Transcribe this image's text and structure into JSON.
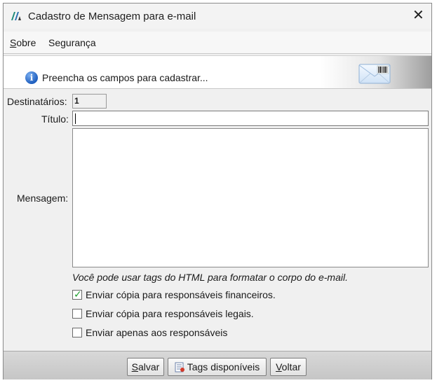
{
  "window": {
    "title": "Cadastro de Mensagem para e-mail",
    "close_symbol": "✕"
  },
  "menu": {
    "items": [
      {
        "label_first": "S",
        "label_rest": "obre"
      },
      {
        "label_first": "",
        "label_rest": "Segurança"
      }
    ]
  },
  "banner": {
    "info_symbol": "i",
    "text": "Preencha os campos para cadastrar...",
    "icon": "envelope-barcode-icon"
  },
  "form": {
    "destinatarios_label": "Destinatários:",
    "destinatarios_value": "1",
    "titulo_label": "Título:",
    "titulo_value": "",
    "mensagem_label": "Mensagem:",
    "mensagem_value": "",
    "hint": "Você pode usar tags do HTML para formatar o corpo do e-mail."
  },
  "options": [
    {
      "label": "Enviar cópia para responsáveis financeiros.",
      "checked": true
    },
    {
      "label": "Enviar cópia para responsáveis legais.",
      "checked": false
    },
    {
      "label": "Enviar apenas aos responsáveis",
      "checked": false
    }
  ],
  "buttons": {
    "save_first": "S",
    "save_rest": "alvar",
    "tags_label": "Tags disponíveis",
    "back_first": "V",
    "back_rest": "oltar"
  },
  "colors": {
    "check": "#1e9e2e",
    "info": "#1f5fbf"
  }
}
